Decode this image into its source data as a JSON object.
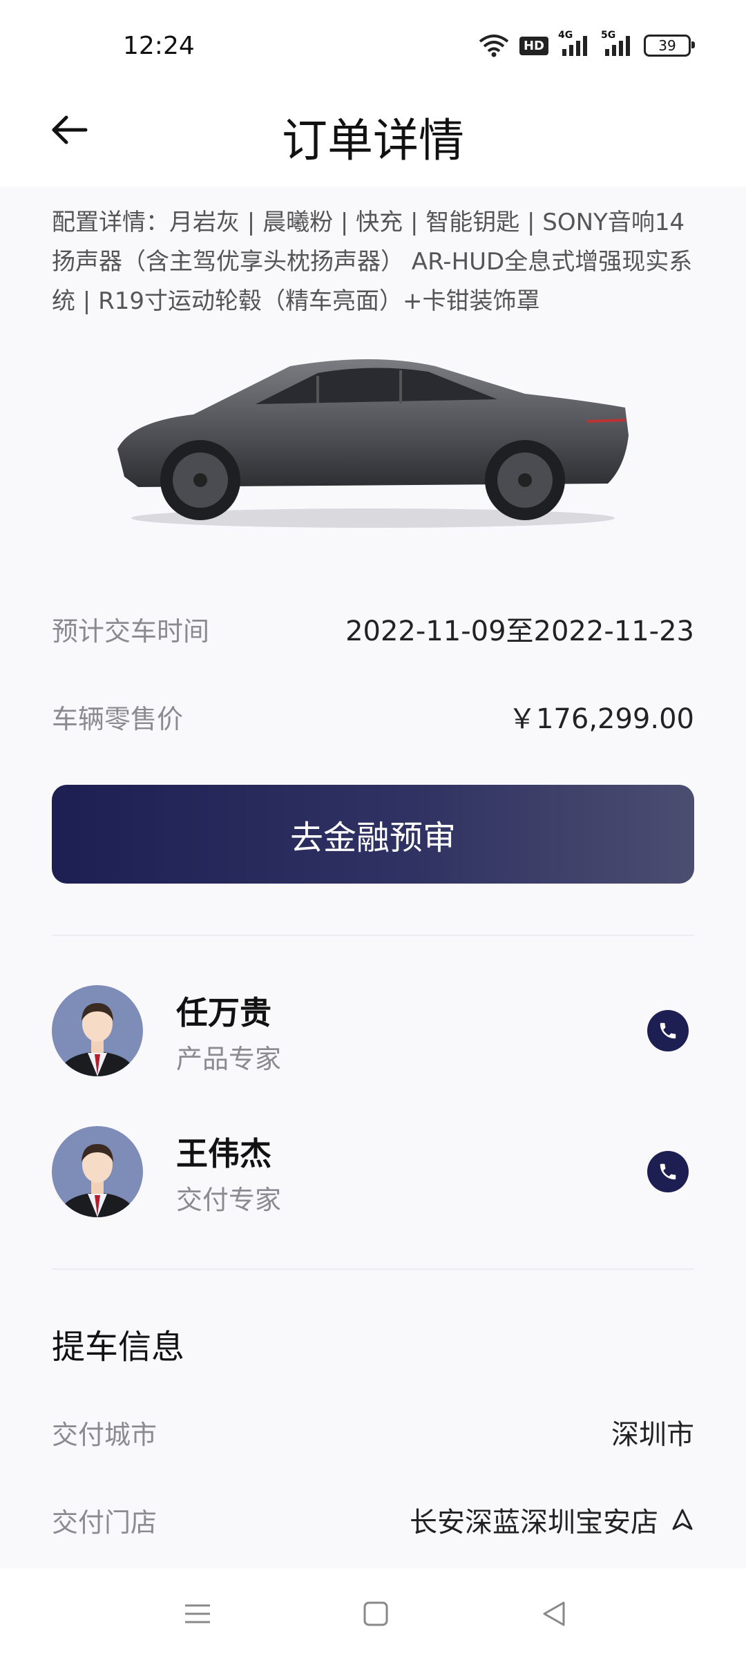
{
  "status": {
    "time": "12:24",
    "battery": "39",
    "hd": "HD",
    "net1": "4G",
    "net2": "5G"
  },
  "header": {
    "title": "订单详情"
  },
  "config": {
    "text": "配置详情：月岩灰 | 晨曦粉 | 快充 | 智能钥匙 | SONY音响14扬声器（含主驾优享头枕扬声器） AR-HUD全息式增强现实系统 | R19寸运动轮毂（精车亮面）+卡钳装饰罩"
  },
  "order": {
    "delivery_time_label": "预计交车时间",
    "delivery_time_value": "2022-11-09至2022-11-23",
    "price_label": "车辆零售价",
    "price_value": "￥176,299.00"
  },
  "cta": {
    "label": "去金融预审"
  },
  "contacts": [
    {
      "name": "任万贵",
      "role": "产品专家"
    },
    {
      "name": "王伟杰",
      "role": "交付专家"
    }
  ],
  "pickup": {
    "title": "提车信息",
    "city_label": "交付城市",
    "city_value": "深圳市",
    "store_label": "交付门店",
    "store_value": "长安深蓝深圳宝安店"
  },
  "colors": {
    "accent": "#1d1f52",
    "background": "#f9f9fc",
    "label": "#8a8a8f"
  }
}
